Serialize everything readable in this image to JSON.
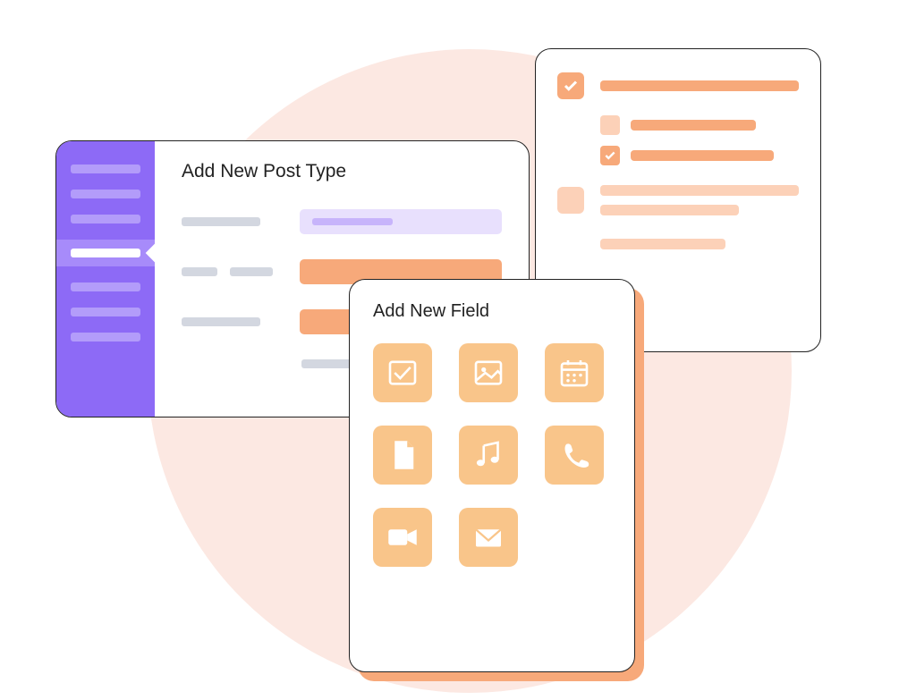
{
  "colors": {
    "accent_orange": "#f7a97a",
    "accent_orange_light": "#fcd1b8",
    "accent_purple": "#8d6af6",
    "tile_bg": "#f9c58a",
    "lavender_input": "#e8e0fd"
  },
  "checklist_card": {
    "items": [
      {
        "checked": true,
        "placeholder": true
      },
      {
        "checked": false,
        "placeholder": true
      },
      {
        "checked": true,
        "placeholder": true
      },
      {
        "checked": false,
        "placeholder": true
      }
    ]
  },
  "post_type_card": {
    "title": "Add New Post Type",
    "sidebar_items": 7,
    "active_index": 3
  },
  "field_card": {
    "title": "Add New Field",
    "fields": [
      {
        "name": "checkbox-icon"
      },
      {
        "name": "image-icon"
      },
      {
        "name": "calendar-icon"
      },
      {
        "name": "file-icon"
      },
      {
        "name": "music-icon"
      },
      {
        "name": "phone-icon"
      },
      {
        "name": "video-icon"
      },
      {
        "name": "email-icon"
      }
    ]
  }
}
